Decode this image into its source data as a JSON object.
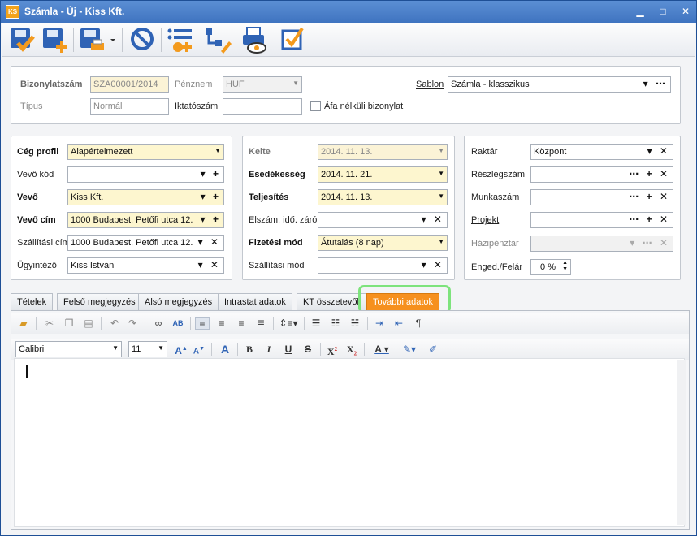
{
  "window": {
    "title": "Számla - Új - Kiss Kft.",
    "logo": "KS"
  },
  "titlebar_buttons": {
    "minimize": "▁",
    "maximize": "□",
    "close": "✕"
  },
  "toolbar": {
    "icons": [
      "save-check-icon",
      "save-new-icon",
      "save-print-icon",
      "cancel-icon",
      "add-items-icon",
      "hierarchy-edit-icon",
      "print-preview-icon",
      "checkbox-icon"
    ]
  },
  "header": {
    "bizonylatszam_label": "Bizonylatszám",
    "bizonylatszam_value": "SZA00001/2014",
    "penznem_label": "Pénznem",
    "penznem_value": "HUF",
    "sablon_label": "Sablon",
    "sablon_value": "Számla - klasszikus",
    "tipus_label": "Típus",
    "tipus_value": "Normál",
    "iktatoszam_label": "Iktatószám",
    "iktatoszam_value": "",
    "afa_label": "Áfa nélküli bizonylat"
  },
  "left": {
    "ceg_profil_label": "Cég profil",
    "ceg_profil_value": "Alapértelmezett",
    "vevo_kod_label": "Vevő kód",
    "vevo_kod_value": "",
    "vevo_label": "Vevő",
    "vevo_value": "Kiss Kft.",
    "vevo_cim_label": "Vevő cím",
    "vevo_cim_value": "1000 Budapest, Petőfi utca 12.",
    "szallitasi_cim_label": "Szállítási cím",
    "szallitasi_cim_value": "1000 Budapest, Petőfi utca 12.",
    "ugyintezo_label": "Ügyintéző",
    "ugyintezo_value": "Kiss István"
  },
  "middle": {
    "kelte_label": "Kelte",
    "kelte_value": "2014. 11. 13.",
    "esedekesseg_label": "Esedékesség",
    "esedekesseg_value": "2014. 11. 21.",
    "teljesites_label": "Teljesítés",
    "teljesites_value": "2014. 11. 13.",
    "elszam_label": "Elszám. idő. záró",
    "elszam_value": "",
    "fizetesi_mod_label": "Fizetési mód",
    "fizetesi_mod_value": "Átutalás (8 nap)",
    "szallitasi_mod_label": "Szállítási mód",
    "szallitasi_mod_value": ""
  },
  "right": {
    "raktar_label": "Raktár",
    "raktar_value": "Központ",
    "reszlegszam_label": "Részlegszám",
    "reszlegszam_value": "",
    "munkaszam_label": "Munkaszám",
    "munkaszam_value": "",
    "projekt_label": "Projekt",
    "projekt_value": "",
    "hazipenztar_label": "Házipénztár",
    "hazipenztar_value": "",
    "enged_label": "Enged./Felár",
    "enged_value": "0 %"
  },
  "tabs": [
    {
      "label": "Tételek"
    },
    {
      "label": "Felső megjegyzés"
    },
    {
      "label": "Alsó megjegyzés"
    },
    {
      "label": "Intrastat adatok"
    },
    {
      "label": "KT összetevők"
    },
    {
      "label": "További adatok"
    }
  ],
  "editor": {
    "font": "Calibri",
    "size": "11"
  },
  "colors": {
    "active_tab": "#f6901e",
    "highlight": "#7de37c",
    "required_field": "#fdf6cf"
  }
}
